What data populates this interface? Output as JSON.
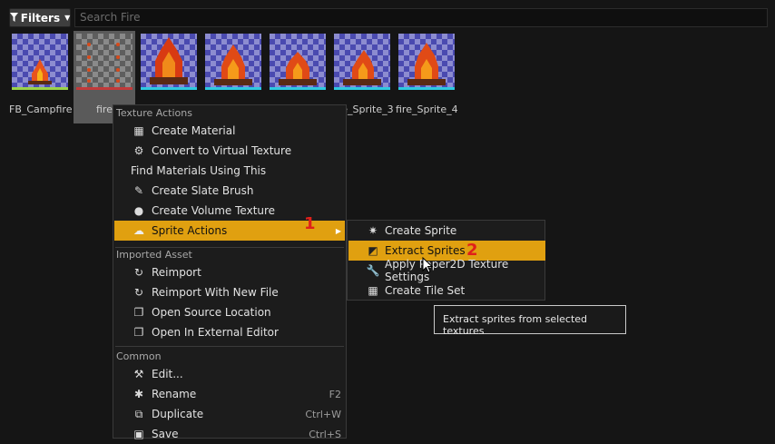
{
  "toolbar": {
    "filters_label": "Filters",
    "search_placeholder": "Search Fire"
  },
  "assets": [
    {
      "label": "FB_Campfire"
    },
    {
      "label": "fire"
    },
    {
      "label": ""
    },
    {
      "label": ""
    },
    {
      "label": ""
    },
    {
      "label": "fire_Sprite_3"
    },
    {
      "label": "fire_Sprite_4"
    }
  ],
  "context_menu": {
    "sections": {
      "texture_actions": "Texture Actions",
      "imported_asset": "Imported Asset",
      "common": "Common"
    },
    "items": {
      "create_material": "Create Material",
      "convert_virtual": "Convert to Virtual Texture",
      "find_materials": "Find Materials Using This",
      "create_slate_brush": "Create Slate Brush",
      "create_volume_texture": "Create Volume Texture",
      "sprite_actions": "Sprite Actions",
      "reimport": "Reimport",
      "reimport_new_file": "Reimport With New File",
      "open_source_location": "Open Source Location",
      "open_external_editor": "Open In External Editor",
      "edit": "Edit...",
      "rename": "Rename",
      "rename_shortcut": "F2",
      "duplicate": "Duplicate",
      "duplicate_shortcut": "Ctrl+W",
      "save": "Save",
      "save_shortcut": "Ctrl+S"
    }
  },
  "submenu": {
    "create_sprite": "Create Sprite",
    "extract_sprites": "Extract Sprites",
    "apply_paper2d": "Apply Paper2D Texture Settings",
    "create_tile_set": "Create Tile Set"
  },
  "tooltip": "Extract sprites from selected textures",
  "annotations": {
    "one": "1",
    "two": "2"
  },
  "colors": {
    "highlight": "#e0a010",
    "annotation": "#e0201a"
  }
}
